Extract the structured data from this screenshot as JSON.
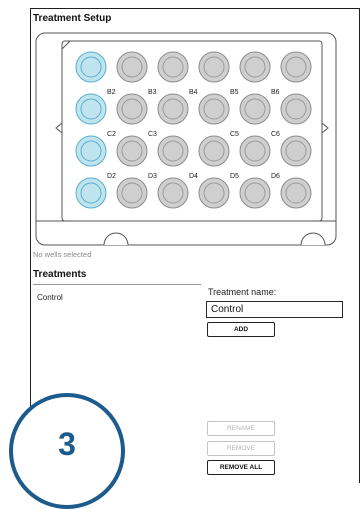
{
  "setup": {
    "title": "Treatment Setup",
    "status": "No wells selected"
  },
  "plate": {
    "rows": [
      "A",
      "B",
      "C",
      "D"
    ],
    "columns": 6,
    "selected_wells": [
      "A1",
      "B1",
      "C1",
      "D1"
    ],
    "well_labels": [
      {
        "well": "B2",
        "text": "B2"
      },
      {
        "well": "B3",
        "text": "B3"
      },
      {
        "well": "B4",
        "text": "B4"
      },
      {
        "well": "B5",
        "text": "B5"
      },
      {
        "well": "B6",
        "text": "B6"
      },
      {
        "well": "C2",
        "text": "C2"
      },
      {
        "well": "C3",
        "text": "C3"
      },
      {
        "well": "C5",
        "text": "C5"
      },
      {
        "well": "C6",
        "text": "C6"
      },
      {
        "well": "D2",
        "text": "D2"
      },
      {
        "well": "D3",
        "text": "D3"
      },
      {
        "well": "D4",
        "text": "D4"
      },
      {
        "well": "D5",
        "text": "D5"
      },
      {
        "well": "D6",
        "text": "D6"
      }
    ],
    "colors": {
      "selected_fill": "#bfe3ef",
      "selected_stroke": "#5aaecb",
      "well_fill": "#cfcfcf",
      "well_stroke": "#8c8c8c",
      "plate_stroke": "#555555"
    }
  },
  "treatments": {
    "title": "Treatments",
    "items": [
      "Control"
    ],
    "name_label": "Treatment name:",
    "name_value": "Control",
    "add_label": "ADD",
    "rename_label": "RENAME",
    "remove_label": "REMOVE",
    "remove_all_label": "REMOVE ALL"
  },
  "step": {
    "number": "3",
    "color": "#1c5b8c"
  }
}
